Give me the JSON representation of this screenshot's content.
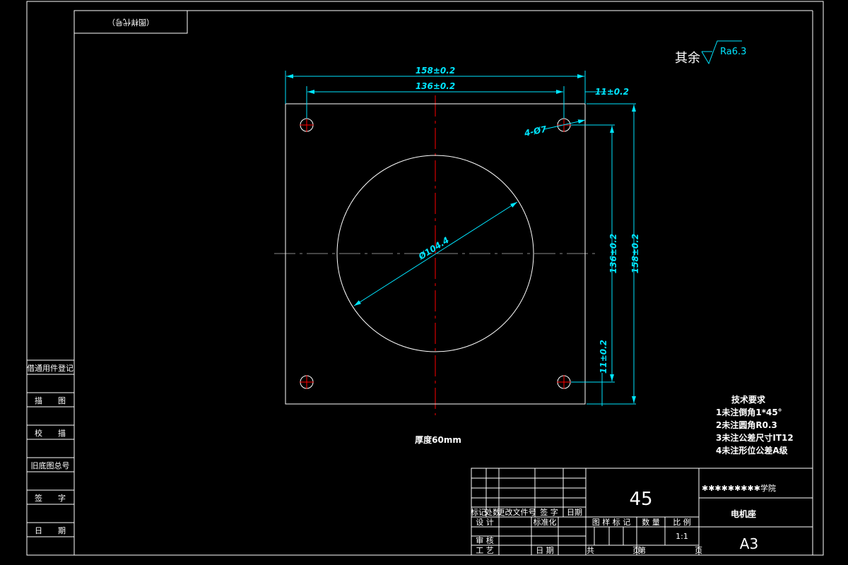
{
  "stamp_label": "（图样代号）",
  "surface_note": {
    "prefix": "其余",
    "roughness": "Ra6.3"
  },
  "dimensions": {
    "overall_width": "158±0.2",
    "hole_spacing_x": "136±0.2",
    "edge_offset_x": "11±0.2",
    "hole_callout": "4-Ø7",
    "bore_diameter": "Ø104.4",
    "hole_spacing_y": "136±0.2",
    "overall_height": "158±0.2",
    "edge_offset_y": "11±0.2"
  },
  "thickness_note": "厚度60mm",
  "tech_requirements": {
    "title": "技术要求",
    "items": [
      "1未注倒角1*45°",
      "2未注圆角R0.3",
      "3未注公差尺寸IT12",
      "4未注形位公差A级"
    ]
  },
  "side_column": [
    "借通用件登记",
    "描　　图",
    "校　　描",
    "旧底图总号",
    "签　　字",
    "日　　期"
  ],
  "title_block": {
    "rev_headers": [
      "标记",
      "处数",
      "更改文件号",
      "签 字",
      "日期"
    ],
    "design": "设 计",
    "standardize": "标准化",
    "review": "审 核",
    "process": "工 艺",
    "date": "日 期",
    "material": "45",
    "mark_header": "图 样 标 记",
    "qty_header": "数 量",
    "scale_header": "比 例",
    "scale": "1:1",
    "total_pages": "共",
    "page_unit": "页",
    "page_no": "第",
    "page_unit2": "页",
    "school": "✱✱✱✱✱✱✱✱✱学院",
    "part_name": "电机座",
    "sheet_size": "A3"
  },
  "colors": {
    "dimension": "#00e5ff",
    "centerline": "#ff0000",
    "geometry": "#ffffff"
  }
}
